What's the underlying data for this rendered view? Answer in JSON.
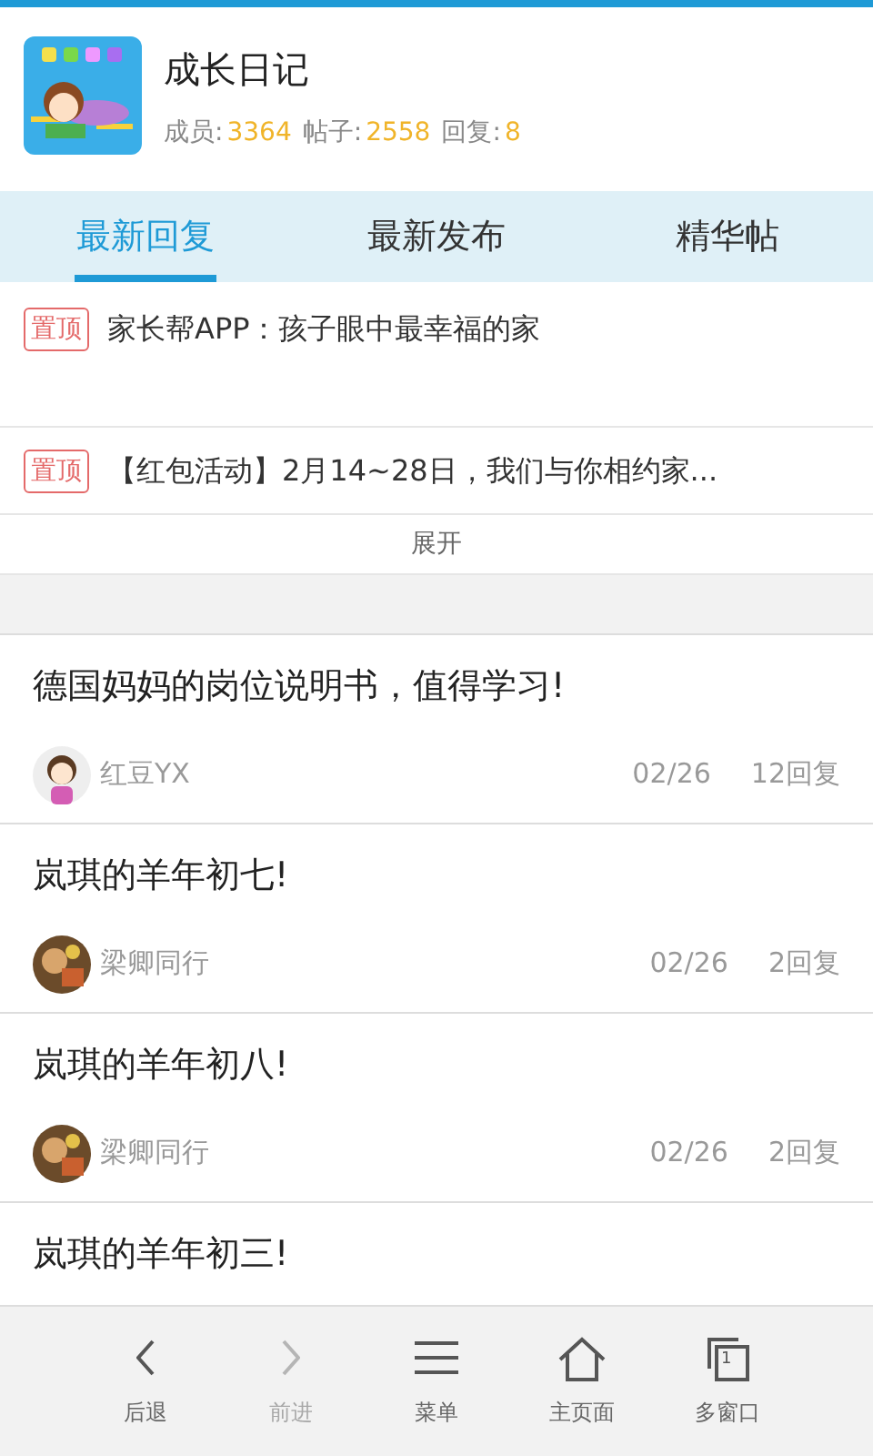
{
  "group": {
    "title": "成长日记",
    "stats": [
      {
        "label": "成员:",
        "value": "3364"
      },
      {
        "label": "帖子:",
        "value": "2558"
      },
      {
        "label": "回复:",
        "value": "8"
      }
    ]
  },
  "tabs": [
    {
      "label": "最新回复",
      "selected": true
    },
    {
      "label": "最新发布",
      "selected": false
    },
    {
      "label": "精华帖",
      "selected": false
    }
  ],
  "pinned": [
    {
      "badge": "置顶",
      "title": "家长帮APP：孩子眼中最幸福的家"
    },
    {
      "badge": "置顶",
      "title": "【红包活动】2月14~28日，我们与你相约家..."
    }
  ],
  "expand": "展开",
  "posts": [
    {
      "title": "德国妈妈的岗位说明书，值得学习!",
      "author": "红豆YX",
      "date": "02/26",
      "replies": "12回复"
    },
    {
      "title": "岚琪的羊年初七!",
      "author": "梁卿同行",
      "date": "02/26",
      "replies": "2回复"
    },
    {
      "title": "岚琪的羊年初八!",
      "author": "梁卿同行",
      "date": "02/26",
      "replies": "2回复"
    },
    {
      "title": "岚琪的羊年初三!"
    }
  ],
  "bottom_nav": [
    {
      "kind": "back",
      "label": "后退",
      "disabled": false
    },
    {
      "kind": "forward",
      "label": "前进",
      "disabled": true
    },
    {
      "kind": "menu",
      "label": "菜单",
      "disabled": false
    },
    {
      "kind": "home",
      "label": "主页面",
      "disabled": false
    },
    {
      "kind": "windows",
      "label": "多窗口",
      "disabled": false,
      "count": "1"
    }
  ]
}
